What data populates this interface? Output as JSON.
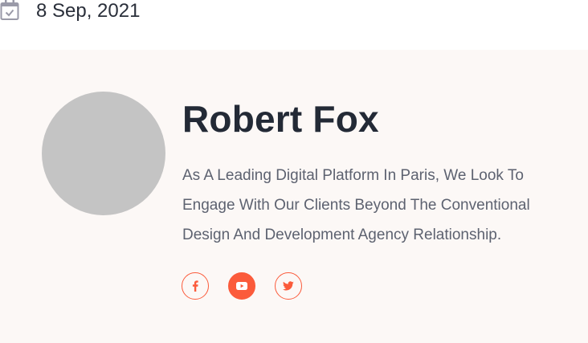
{
  "post_meta": {
    "date": "8 Sep, 2021",
    "date_icon": "calendar-check-icon"
  },
  "author": {
    "name": "Robert Fox",
    "bio": "As A Leading Digital Platform In Paris, We Look To Engage With Our Clients Beyond The Conventional Design And Development Agency Relationship.",
    "avatar_color": "#c4c4c4",
    "socials": [
      {
        "icon": "facebook-icon",
        "style": "outline"
      },
      {
        "icon": "youtube-icon",
        "style": "filled"
      },
      {
        "icon": "twitter-icon",
        "style": "outline"
      }
    ]
  },
  "colors": {
    "accent": "#fb5b3b",
    "panel_background": "#fcf8f6",
    "heading": "#232a36",
    "body_text": "#5d6270",
    "icon_gray": "#9a9aa8"
  }
}
